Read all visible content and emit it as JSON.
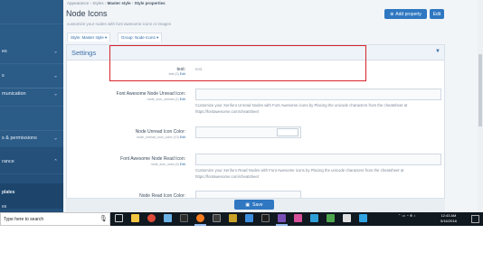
{
  "breadcrumb": {
    "items": [
      "Appearance",
      "Styles",
      "Master style",
      "Style properties"
    ],
    "separator": "›"
  },
  "page": {
    "title": "Node Icons",
    "description": "customize your nodes with font awesome icons or images"
  },
  "top_buttons": {
    "add_property": "Add property",
    "edit": "Edit"
  },
  "filters": {
    "style": "Style: Master style ▾",
    "group": "Group: Node Icons ▾"
  },
  "sidebar": {
    "items": [
      {
        "label": ""
      },
      {
        "label": "es"
      },
      {
        "label": ""
      },
      {
        "label": "s"
      },
      {
        "label": "munication"
      },
      {
        "label": ""
      },
      {
        "label": "s & permissions"
      },
      {
        "label": "rance"
      }
    ],
    "sub_items": [
      "plates",
      "es"
    ]
  },
  "panel": {
    "title": "Settings",
    "rows": [
      {
        "label": "test:",
        "hint": "test (0)",
        "edit": "Edit",
        "value": "test",
        "explain": ""
      },
      {
        "label": "Font Awesome Node Unread Icon:",
        "hint": "node_icon_unread (1)",
        "edit": "Edit",
        "value": "",
        "explain": "Customize your Xenforo Unread Nodes with Font Awesome icons by Placing the unicode characters from the cheatsheet at https://fontawesome.com/cheatsheet"
      },
      {
        "label": "Node Unread Icon Color:",
        "hint": "node_unread_icon_color (10)",
        "edit": "Edit",
        "value": "",
        "explain": ""
      },
      {
        "label": "Font Awesome Node Read Icon:",
        "hint": "node_icon_read (4)",
        "edit": "Edit",
        "value": "",
        "explain": "Customize your Xenforo Read Nodes with Font Awesome icons by Placing the unicode characters from the cheatsheet at https://fontawesome.com/cheatsheet"
      },
      {
        "label": "Node Read Icon Color:",
        "hint": "",
        "edit": "",
        "value": "",
        "explain": ""
      }
    ],
    "save": "Save"
  },
  "taskbar": {
    "search_placeholder": "Type here to search",
    "clock_time": "12:43 AM",
    "clock_date": "5/16/2018"
  },
  "colors": {
    "sidebar": "#2b5b87",
    "accent": "#2f77c1",
    "highlight": "#d8232a"
  }
}
